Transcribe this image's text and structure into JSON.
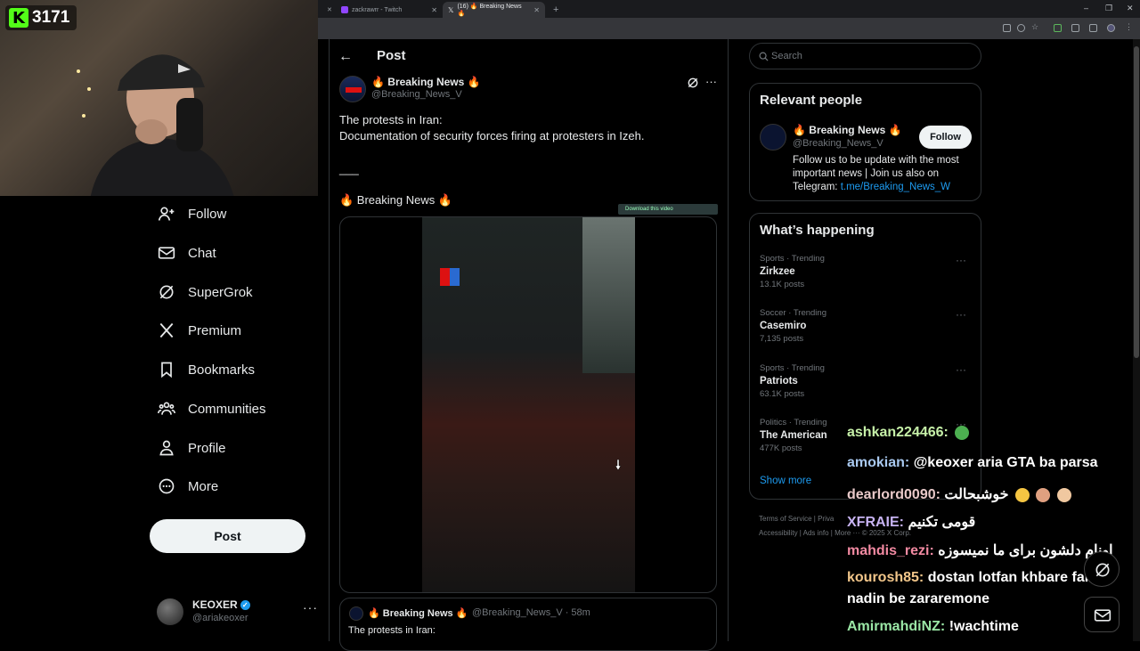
{
  "stream": {
    "kick_count": "3171"
  },
  "browser": {
    "tabs": [
      {
        "label": "zackrawrr - Twitch",
        "active": false
      },
      {
        "label": "(16) 🔥 Breaking News 🔥",
        "active": true
      }
    ]
  },
  "nav": {
    "items": [
      "Follow",
      "Chat",
      "SuperGrok",
      "Premium",
      "Bookmarks",
      "Communities",
      "Profile",
      "More"
    ],
    "post_button": "Post",
    "account": {
      "name": "KEOXER",
      "handle": "@ariakeoxer"
    }
  },
  "post": {
    "header_title": "Post",
    "author_name": "🔥 Breaking News 🔥",
    "author_handle": "@Breaking_News_V",
    "line1": "The protests in Iran:",
    "line2": "Documentation of security forces firing at protesters in Izeh.",
    "separator": "___",
    "signature": "🔥 Breaking News 🔥",
    "download_label": "Download this video",
    "quote": {
      "name": "🔥 Breaking News 🔥",
      "meta": "@Breaking_News_V · 58m",
      "text": "The protests in Iran:"
    }
  },
  "sidebar": {
    "search_placeholder": "Search",
    "relevant": {
      "title": "Relevant people",
      "name": "🔥 Breaking News 🔥",
      "handle": "@Breaking_News_V",
      "follow_label": "Follow",
      "bio": "Follow us to be update with the most important news | Join us also on Telegram: ",
      "bio_link": "t.me/Breaking_News_W"
    },
    "happening": {
      "title": "What’s happening",
      "trends": [
        {
          "category": "Sports · Trending",
          "name": "Zirkzee",
          "count": "13.1K posts"
        },
        {
          "category": "Soccer · Trending",
          "name": "Casemiro",
          "count": "7,135 posts"
        },
        {
          "category": "Sports · Trending",
          "name": "Patriots",
          "count": "63.1K posts"
        },
        {
          "category": "Politics · Trending",
          "name": "The American",
          "count": "477K posts"
        }
      ],
      "show_more": "Show more"
    },
    "footer": {
      "line1": "Terms of Service  |  Priva",
      "line2": "Accessibility  |  Ads info  |  More ···  © 2025 X Corp."
    }
  },
  "chat": [
    {
      "user": "ashkan224466:",
      "msg": "",
      "color": "#c6f0a8"
    },
    {
      "user": "amokian:",
      "msg": "@keoxer aria GTA ba parsa",
      "color": "#a9c9f0"
    },
    {
      "user": "dearlord0090:",
      "msg": "خوشبحالت",
      "color": "#e8c9c9"
    },
    {
      "user": "XFRAIE:",
      "msg": "قومی تکنیم",
      "color": "#c7b3f2"
    },
    {
      "user": "mahdis_rezi:",
      "msg": "اونام دلشون برای ما نمیسوزه",
      "color": "#f28aa2"
    },
    {
      "user": "kourosh85:",
      "msg": "dostan lotfan khbare fake",
      "msg2": "nadin be zararemone",
      "color": "#f2c68a"
    },
    {
      "user": "AmirmahdiNZ:",
      "msg": "!wachtime",
      "color": "#9be7a6"
    }
  ]
}
